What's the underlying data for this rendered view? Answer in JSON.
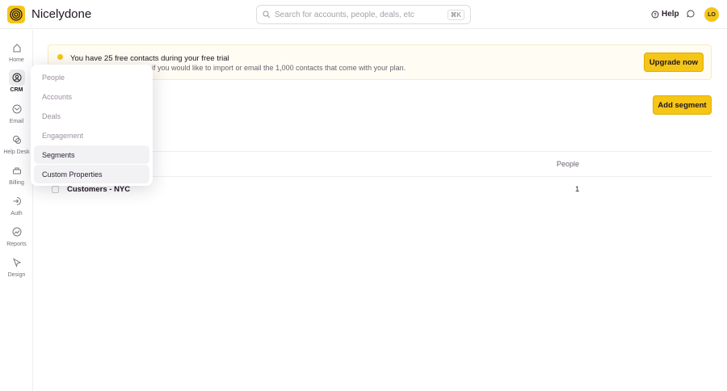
{
  "app": {
    "title": "Nicelydone"
  },
  "search": {
    "placeholder": "Search for accounts, people, deals, etc",
    "shortcut": "⌘K"
  },
  "header": {
    "help": "Help",
    "avatar": "LO"
  },
  "sidebar": {
    "items": [
      {
        "label": "Home"
      },
      {
        "label": "CRM"
      },
      {
        "label": "Email"
      },
      {
        "label": "Help Desk"
      },
      {
        "label": "Billing"
      },
      {
        "label": "Auth"
      },
      {
        "label": "Reports"
      },
      {
        "label": "Design"
      }
    ]
  },
  "banner": {
    "title": "You have 25 free contacts during your free trial",
    "text": "w if you would like to import or email the 1,000 contacts that come with your plan.",
    "button": "Upgrade now"
  },
  "main": {
    "add_button": "Add segment",
    "table": {
      "columns": [
        "People"
      ],
      "rows": [
        {
          "name": "Customers - NYC",
          "people": "1"
        }
      ]
    }
  },
  "menu": {
    "items": [
      {
        "label": "People"
      },
      {
        "label": "Accounts"
      },
      {
        "label": "Deals"
      },
      {
        "label": "Engagement"
      },
      {
        "label": "Segments"
      },
      {
        "label": "Custom Properties"
      }
    ]
  },
  "colors": {
    "accent": "#f5c518"
  }
}
